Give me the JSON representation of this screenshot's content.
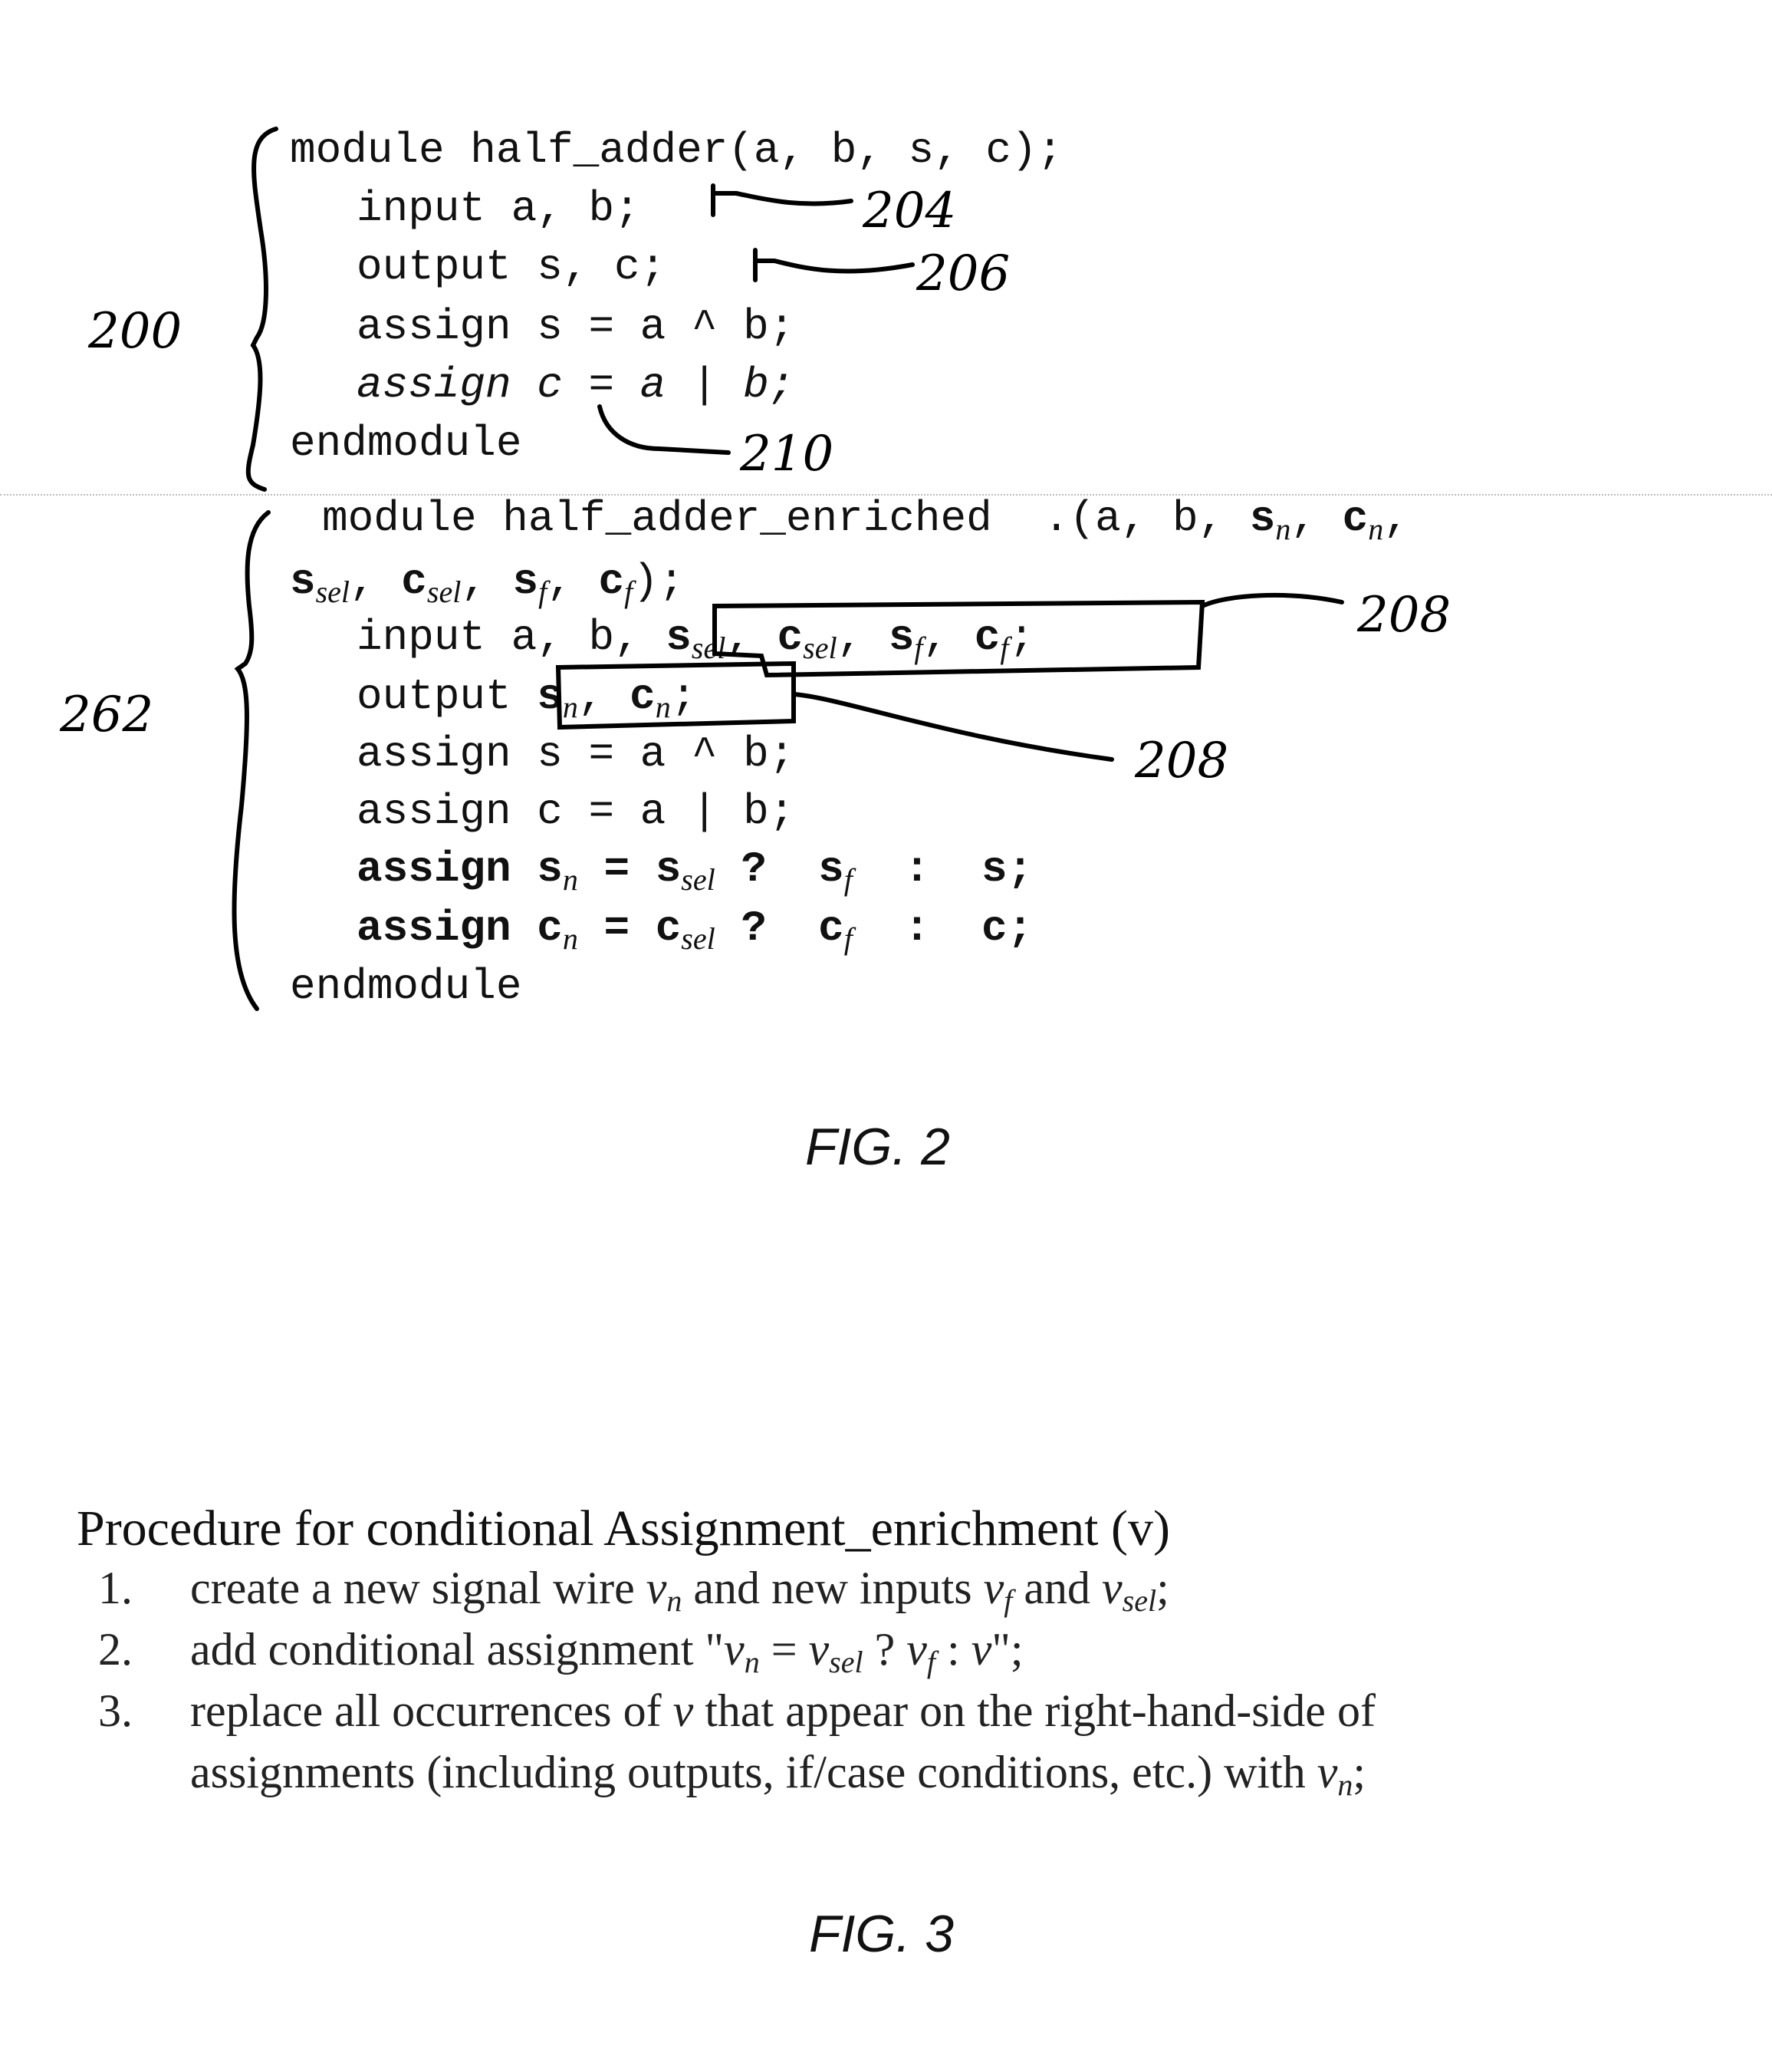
{
  "fig2": {
    "block1": {
      "label": "200",
      "lines": [
        "module half_adder(a, b, s, c);",
        "input a, b;",
        "output s, c;",
        "assign s = a ^ b;",
        "assign c = a | b;",
        "endmodule"
      ],
      "callouts": {
        "input": "204",
        "output": "206",
        "assign_c": "210"
      }
    },
    "block2": {
      "label": "262",
      "line1_prefix": "module half_adder_enriched  .(a, b, ",
      "line1_vars": [
        "s",
        "n",
        "c",
        "n"
      ],
      "line2": {
        "vars": [
          "s",
          "sel",
          "c",
          "sel",
          "s",
          "f",
          "c",
          "f"
        ],
        "suffix": ");"
      },
      "input_prefix": "input a, b,",
      "output_prefix": "output",
      "assign_s": "assign s = a ^ b;",
      "assign_c": "assign c = a | b;",
      "assign_sn": {
        "kw": "assign",
        "lhs": "s",
        "lhs_sub": "n",
        "eq": "=",
        "cond": "s",
        "cond_sub": "sel",
        "q": "?",
        "t": "s",
        "t_sub": "f",
        "colon": ":",
        "f": "s;"
      },
      "assign_cn": {
        "kw": "assign",
        "lhs": "c",
        "lhs_sub": "n",
        "eq": "=",
        "cond": "c",
        "cond_sub": "sel",
        "q": "?",
        "t": "c",
        "t_sub": "f",
        "colon": ":",
        "f": "c;"
      },
      "end": "endmodule",
      "callouts": {
        "inputs_box": "208",
        "outputs_box": "208"
      }
    },
    "caption": "FIG. 2"
  },
  "fig3": {
    "title": "Procedure for conditional Assignment_enrichment (v)",
    "items": [
      {
        "num": "1.",
        "text": "create a new signal wire v_n and new inputs v_f and v_sel;"
      },
      {
        "num": "2.",
        "text": "add conditional assignment \"v_n = v_sel ? v_f : v\";"
      },
      {
        "num": "3.",
        "text": "replace all occurrences of v that appear on the right-hand-side of",
        "cont": "assignments (including outputs, if/case conditions, etc.) with v_n;"
      }
    ],
    "caption": "FIG. 3"
  }
}
